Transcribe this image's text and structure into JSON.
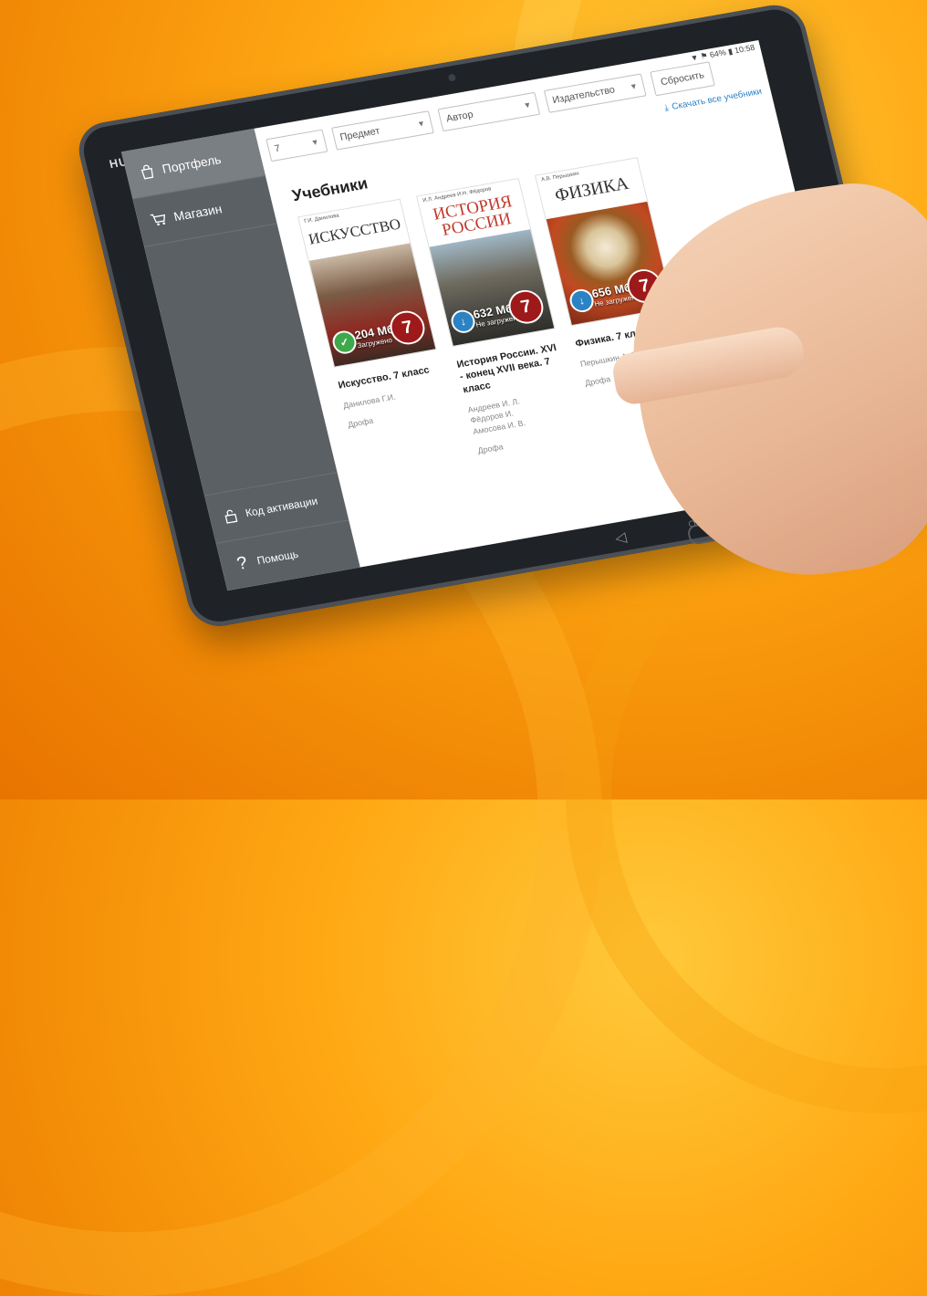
{
  "device": {
    "brand": "HUAWEI",
    "status": "▼ ⚑ 64% ▮ 10:58"
  },
  "sidebar": {
    "items": [
      {
        "label": "Портфель",
        "icon": "bag-icon",
        "active": true
      },
      {
        "label": "Магазин",
        "icon": "cart-icon",
        "active": false
      }
    ],
    "bottom_items": [
      {
        "label": "Код активации",
        "icon": "lock-icon"
      },
      {
        "label": "Помощь",
        "icon": "help-icon"
      }
    ]
  },
  "filters": {
    "grade": "7",
    "subject": "Предмет",
    "author": "Автор",
    "publisher": "Издательство",
    "reset": "Сбросить"
  },
  "download_all": "Скачать все учебники",
  "section_title": "Учебники",
  "books": [
    {
      "cover_author": "Г.И. Данилова",
      "cover_title": "ИСКУССТВО",
      "size": "204 Мб",
      "state": "Загружено",
      "grade": "7",
      "title": "Искусство. 7 класс",
      "authors": "Данилова Г.И.",
      "publisher": "Дрофа",
      "downloaded": true
    },
    {
      "cover_author": "И.Л. Андреев И.Н. Фёдоров",
      "cover_title": "ИСТОРИЯ РОССИИ",
      "size": "632 Мб",
      "state": "Не загружено",
      "grade": "7",
      "title": "История России. XVI - конец XVII века. 7 класс",
      "authors": "Андреев И. Л.\nФёдоров И.\nАмосова И. В.",
      "publisher": "Дрофа",
      "downloaded": false
    },
    {
      "cover_author": "А.В. Перышкин",
      "cover_title": "ФИЗИКА",
      "size": "656 Мб",
      "state": "Не загружено",
      "grade": "7",
      "title": "Физика. 7 класс",
      "authors": "Перышкин А. В.",
      "publisher": "Дрофа",
      "downloaded": false
    }
  ],
  "navbar": {
    "back": "◁",
    "home": "○",
    "recent": "□"
  }
}
